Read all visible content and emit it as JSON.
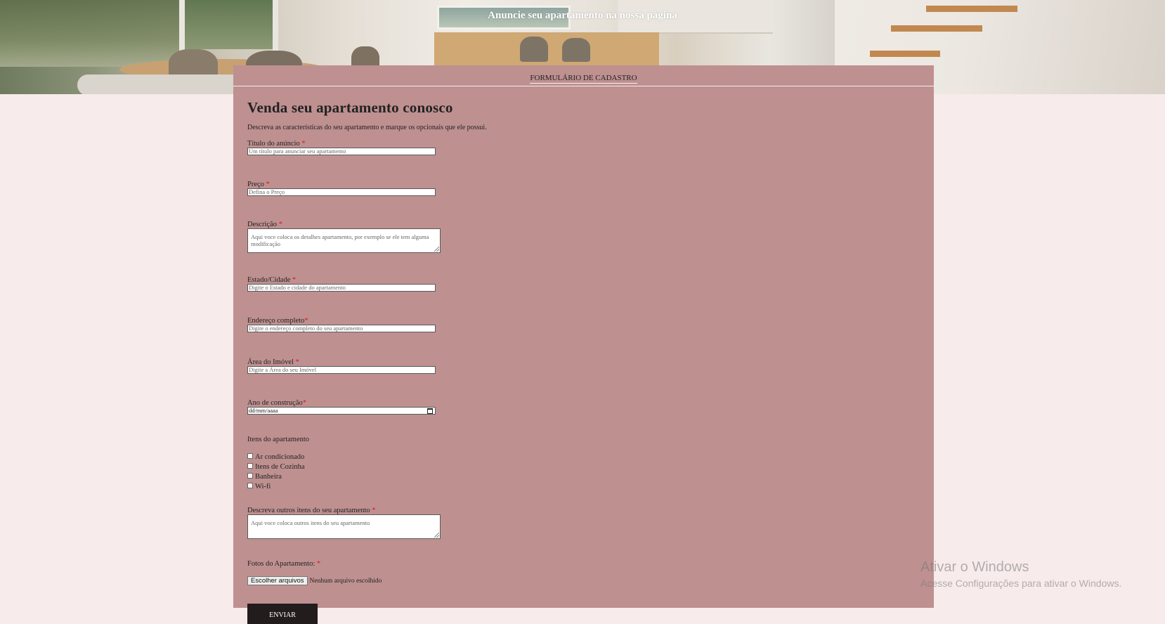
{
  "hero": {
    "title": "Anuncie seu apartamento na nossa página"
  },
  "nav": {
    "link": "FORMULÁRIO DE CADASTRO"
  },
  "form": {
    "heading": "Venda seu apartamento conosco",
    "intro": "Descreva as características do seu apartamento e marque os opcionais que ele possui.",
    "required_mark": "*",
    "fields": {
      "titulo": {
        "label": "Título do anúncio",
        "placeholder": "Um título para anunciar seu apartamento"
      },
      "preco": {
        "label": "Preço",
        "placeholder": "Defina o Preço"
      },
      "descricao": {
        "label": "Descrição",
        "placeholder": "Aqui voce coloca os detalhes apartamento, por exemplo se ele tem alguma modificação"
      },
      "estado": {
        "label": "Estado/Cidade",
        "placeholder": "Digite o Estado e cidade do apartamento"
      },
      "endereco": {
        "label": "Endereço completo",
        "placeholder": "Digite o endereço completo do seu apartamento"
      },
      "area": {
        "label": "Área do Imóvel",
        "placeholder": "Digite a Área do seu Imóvel"
      },
      "ano": {
        "label": "Ano de construção",
        "placeholder": "dd/mm/aaaa"
      },
      "outros": {
        "label": "Descreva outros itens do seu apartamento",
        "placeholder": "Aqui voce coloca outros itens do seu apartamento"
      },
      "fotos": {
        "label": "Fotos do Apartamento:",
        "button": "Escolher arquivos",
        "status": "Nenhum arquivo escolhido"
      }
    },
    "items_title": "Itens do apartamento",
    "items": [
      "Ar condicionado",
      "Itens de Cozinha",
      "Banheira",
      "Wi-fi"
    ],
    "submit": "ENVIAR"
  },
  "watermark": {
    "line1": "Ativar o Windows",
    "line2": "Acesse Configurações para ativar o Windows."
  },
  "colors": {
    "background": "#f8ebeb",
    "panel": "#bf9090",
    "button": "#231c1c",
    "required": "#d41e1e"
  }
}
